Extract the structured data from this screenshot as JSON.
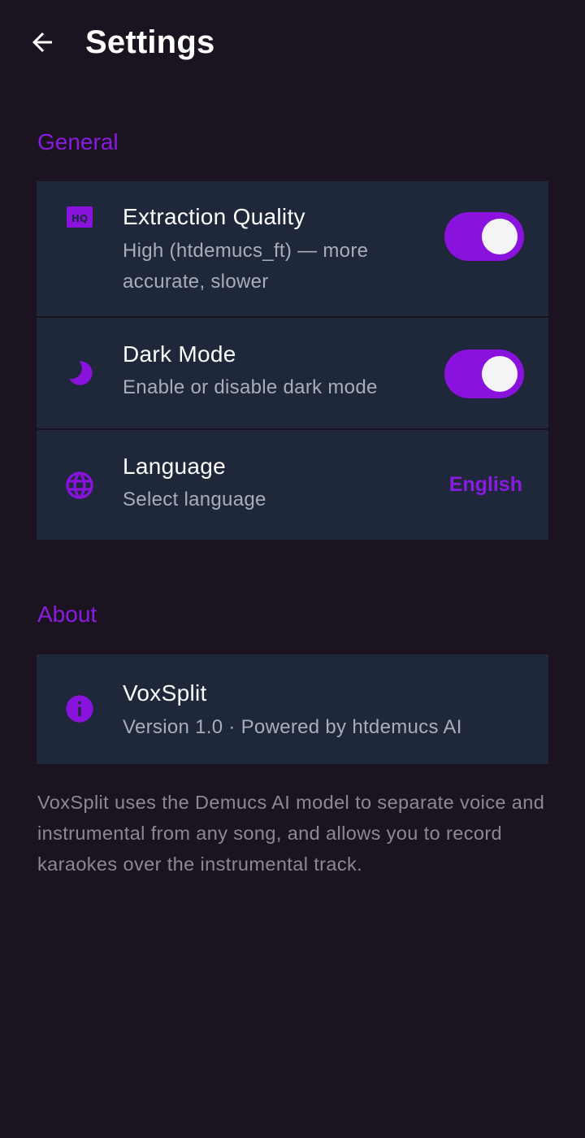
{
  "header": {
    "title": "Settings",
    "back_icon": "arrow-left-icon"
  },
  "colors": {
    "background": "#1b1320",
    "card": "#1f283b",
    "accent": "#8a1be2",
    "subtitle": "#a8adb8"
  },
  "general": {
    "header": "General",
    "extraction_quality": {
      "icon": "hq-icon",
      "title": "Extraction Quality",
      "subtitle_line1": "High (htdemucs_ft) — more",
      "subtitle_line2": "accurate, slower",
      "enabled": true
    },
    "dark_mode": {
      "icon": "moon-icon",
      "title": "Dark Mode",
      "subtitle": "Enable or disable dark mode",
      "enabled": true
    },
    "language": {
      "icon": "globe-icon",
      "title": "Language",
      "subtitle": "Select language",
      "value": "English"
    }
  },
  "about": {
    "header": "About",
    "app": {
      "icon": "info-icon",
      "title": "VoxSplit",
      "subtitle": "Version 1.0 · Powered by htdemucs AI"
    },
    "description": "VoxSplit uses the Demucs AI model to separate voice and instrumental from any song, and allows you to record karaokes over the instrumental track."
  }
}
